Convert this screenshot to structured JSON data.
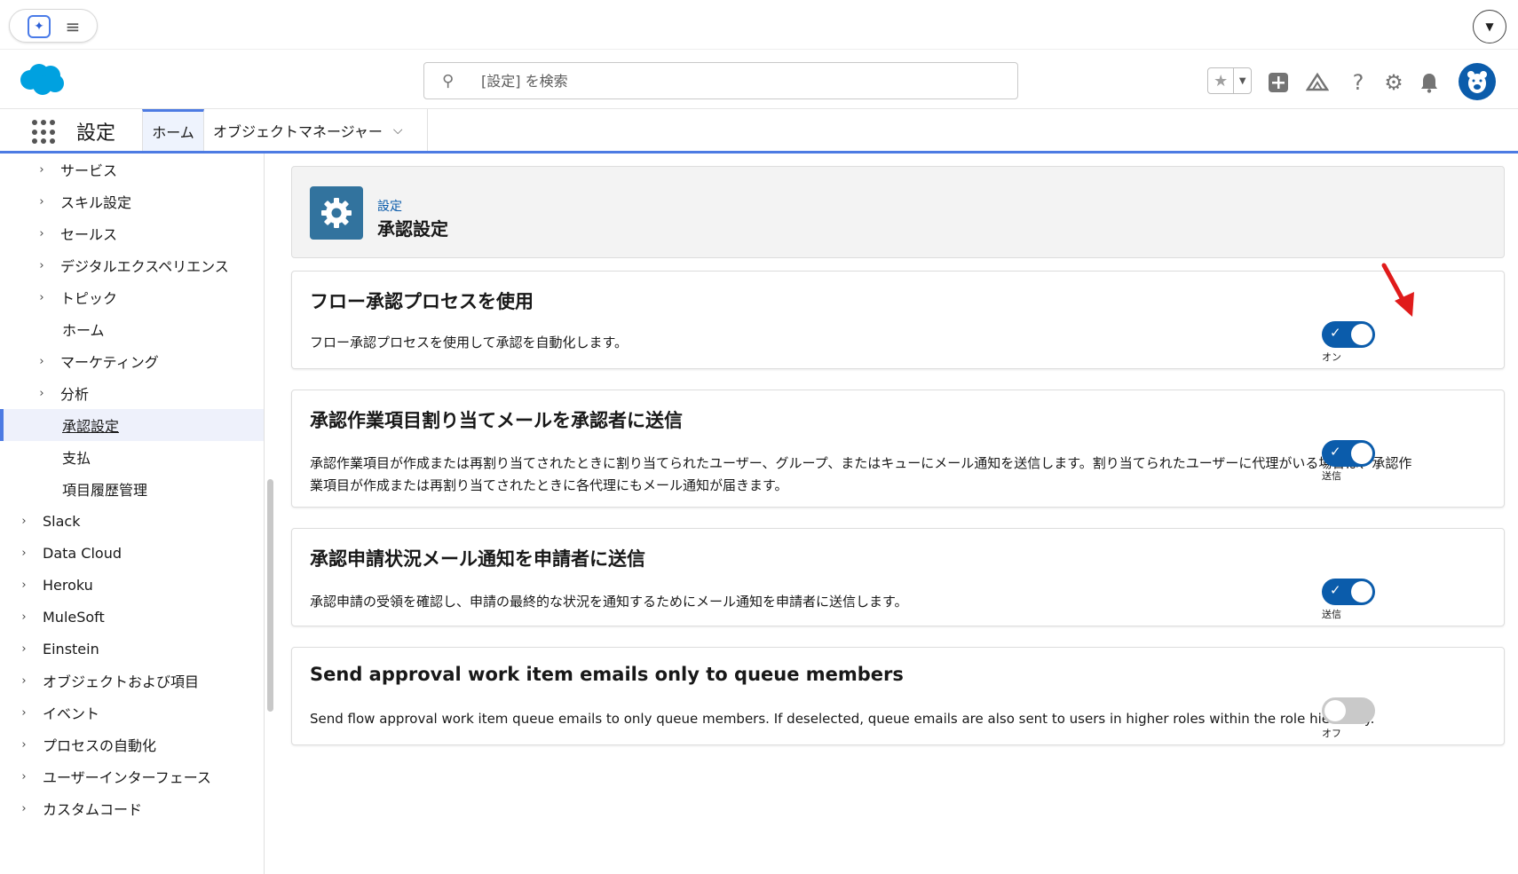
{
  "header": {
    "search_placeholder": "[設定] を検索",
    "brand_color": "#00a1e0",
    "accent_color": "#0b5cab"
  },
  "appnav": {
    "app_name": "設定",
    "tabs": [
      {
        "label": "ホーム",
        "selected": true
      },
      {
        "label": "オブジェクトマネージャー",
        "selected": false
      }
    ]
  },
  "sidebar": {
    "items": [
      {
        "label": "サービス"
      },
      {
        "label": "スキル設定"
      },
      {
        "label": "セールス"
      },
      {
        "label": "デジタルエクスペリエンス"
      },
      {
        "label": "トピック"
      },
      {
        "label": "ホーム"
      },
      {
        "label": "マーケティング"
      },
      {
        "label": "分析"
      },
      {
        "label": "承認設定"
      },
      {
        "label": "支払"
      },
      {
        "label": "項目履歴管理"
      },
      {
        "label": "Slack"
      },
      {
        "label": "Data Cloud"
      },
      {
        "label": "Heroku"
      },
      {
        "label": "MuleSoft"
      },
      {
        "label": "Einstein"
      },
      {
        "label": "オブジェクトおよび項目"
      },
      {
        "label": "イベント"
      },
      {
        "label": "プロセスの自動化"
      },
      {
        "label": "ユーザーインターフェース"
      },
      {
        "label": "カスタムコード"
      }
    ]
  },
  "page": {
    "breadcrumb": "設定",
    "title": "承認設定"
  },
  "settings": [
    {
      "title": "フロー承認プロセスを使用",
      "description": "フロー承認プロセスを使用して承認を自動化します。",
      "state": "on",
      "state_label": "オン"
    },
    {
      "title": "承認作業項目割り当てメールを承認者に送信",
      "description": "承認作業項目が作成または再割り当てされたときに割り当てられたユーザー、グループ、またはキューにメール通知を送信します。割り当てられたユーザーに代理がいる場合は、承認作業項目が作成または再割り当てされたときに各代理にもメール通知が届きます。",
      "state": "on",
      "state_label": "送信"
    },
    {
      "title": "承認申請状況メール通知を申請者に送信",
      "description": "承認申請の受領を確認し、申請の最終的な状況を通知するためにメール通知を申請者に送信します。",
      "state": "on",
      "state_label": "送信"
    },
    {
      "title": "Send approval work item emails only to queue members",
      "description": "Send flow approval work item queue emails to only queue members. If deselected, queue emails are also sent to users in higher roles within the role hierarchy.",
      "state": "off",
      "state_label": "オフ"
    }
  ]
}
